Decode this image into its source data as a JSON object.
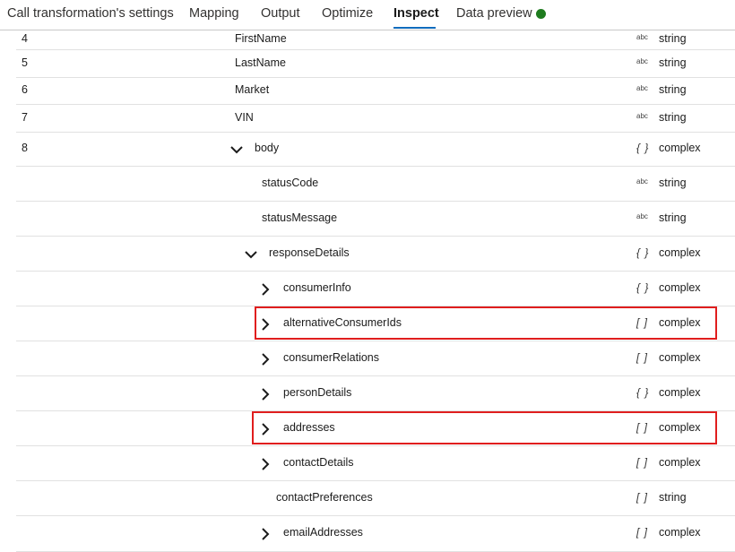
{
  "tabs": [
    {
      "label": "Call transformation's settings",
      "active": false
    },
    {
      "label": "Mapping",
      "active": false
    },
    {
      "label": "Output",
      "active": false
    },
    {
      "label": "Optimize",
      "active": false
    },
    {
      "label": "Inspect",
      "active": true
    },
    {
      "label": "Data preview",
      "active": false,
      "status": "green-dot-icon"
    }
  ],
  "colors": {
    "accent": "#0f6cbd",
    "highlight": "#e01e1e",
    "status": "#1e7b1e"
  },
  "rows": [
    {
      "index": "4",
      "name": "FirstName",
      "type_icon": "abc",
      "type": "string",
      "chevron": "none"
    },
    {
      "index": "5",
      "name": "LastName",
      "type_icon": "abc",
      "type": "string",
      "chevron": "none"
    },
    {
      "index": "6",
      "name": "Market",
      "type_icon": "abc",
      "type": "string",
      "chevron": "none"
    },
    {
      "index": "7",
      "name": "VIN",
      "type_icon": "abc",
      "type": "string",
      "chevron": "none"
    },
    {
      "index": "8",
      "name": "body",
      "type_icon": "{ }",
      "type": "complex",
      "chevron": "down"
    },
    {
      "index": "",
      "name": "statusCode",
      "type_icon": "abc",
      "type": "string",
      "chevron": "none"
    },
    {
      "index": "",
      "name": "statusMessage",
      "type_icon": "abc",
      "type": "string",
      "chevron": "none"
    },
    {
      "index": "",
      "name": "responseDetails",
      "type_icon": "{ }",
      "type": "complex",
      "chevron": "down"
    },
    {
      "index": "",
      "name": "consumerInfo",
      "type_icon": "{ }",
      "type": "complex",
      "chevron": "right"
    },
    {
      "index": "",
      "name": "alternativeConsumerIds",
      "type_icon": "[ ]",
      "type": "complex",
      "chevron": "right",
      "highlighted": true
    },
    {
      "index": "",
      "name": "consumerRelations",
      "type_icon": "[ ]",
      "type": "complex",
      "chevron": "right"
    },
    {
      "index": "",
      "name": "personDetails",
      "type_icon": "{ }",
      "type": "complex",
      "chevron": "right"
    },
    {
      "index": "",
      "name": "addresses",
      "type_icon": "[ ]",
      "type": "complex",
      "chevron": "right",
      "highlighted": true
    },
    {
      "index": "",
      "name": "contactDetails",
      "type_icon": "[ ]",
      "type": "complex",
      "chevron": "right"
    },
    {
      "index": "",
      "name": "contactPreferences",
      "type_icon": "[ ]",
      "type": "string",
      "chevron": "none"
    },
    {
      "index": "",
      "name": "emailAddresses",
      "type_icon": "[ ]",
      "type": "complex",
      "chevron": "right"
    }
  ]
}
